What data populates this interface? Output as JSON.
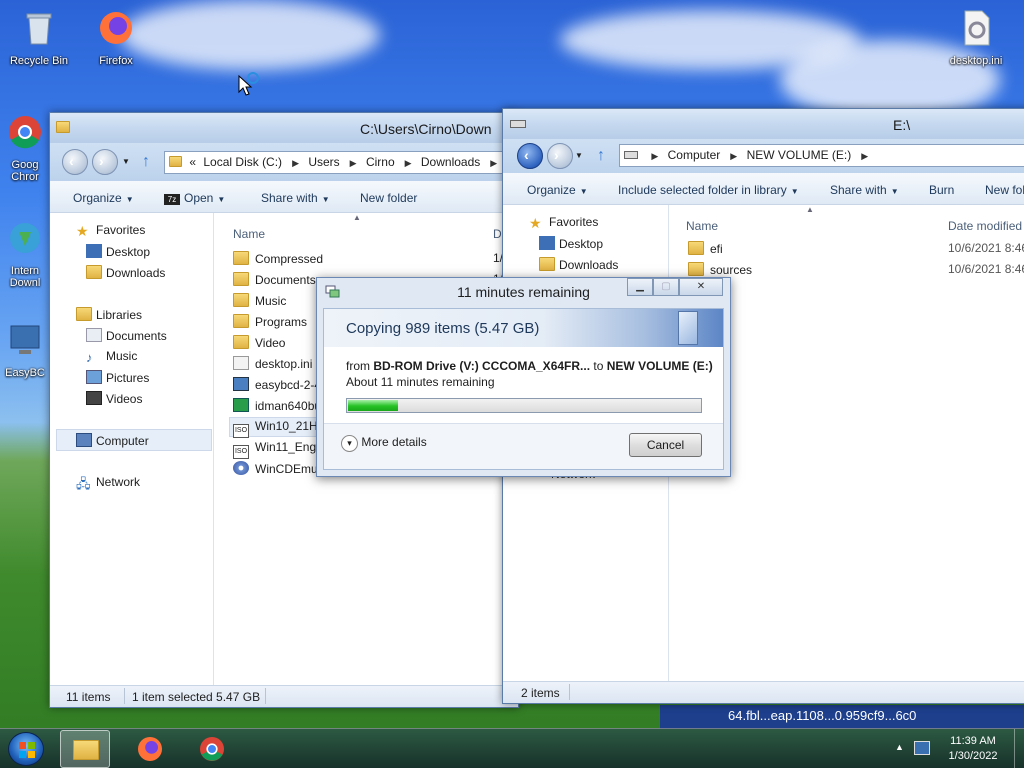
{
  "desktop": {
    "icons": [
      {
        "label": "Recycle Bin",
        "icon": "recycle-bin-icon"
      },
      {
        "label": "Firefox",
        "icon": "firefox-icon"
      },
      {
        "label": "desktop.ini",
        "icon": "settings-file-icon"
      },
      {
        "label": "Goog Chror",
        "icon": "chrome-icon"
      },
      {
        "label": "Intern Downl",
        "icon": "download-manager-icon"
      },
      {
        "label": "EasyBC",
        "icon": "easybcd-icon"
      }
    ],
    "wallpaper_text": "64.fbl...eap.1108...0.959cf9...6c0"
  },
  "left_window": {
    "title": "C:\\Users\\Cirno\\Down",
    "address": {
      "prefix": "«",
      "parts": [
        "Local Disk (C:)",
        "Users",
        "Cirno",
        "Downloads"
      ]
    },
    "toolbar": {
      "organize": "Organize",
      "open": "Open",
      "share": "Share with",
      "new_folder": "New folder"
    },
    "nav": {
      "favorites": "Favorites",
      "desktop": "Desktop",
      "downloads": "Downloads",
      "libraries": "Libraries",
      "documents": "Documents",
      "music": "Music",
      "pictures": "Pictures",
      "videos": "Videos",
      "computer": "Computer",
      "network": "Network"
    },
    "col_name": "Name",
    "col_date": "D",
    "files": [
      {
        "name": "Compressed",
        "type": "folder",
        "date": "1/"
      },
      {
        "name": "Documents",
        "type": "folder",
        "date": "1/"
      },
      {
        "name": "Music",
        "type": "folder",
        "date": ""
      },
      {
        "name": "Programs",
        "type": "folder",
        "date": ""
      },
      {
        "name": "Video",
        "type": "folder",
        "date": ""
      },
      {
        "name": "desktop.ini",
        "type": "ini",
        "date": ""
      },
      {
        "name": "easybcd-2-4",
        "type": "exe",
        "date": ""
      },
      {
        "name": "idman640bu",
        "type": "exe",
        "date": ""
      },
      {
        "name": "Win10_21H2",
        "type": "iso",
        "date": ""
      },
      {
        "name": "Win11_Engli",
        "type": "iso",
        "date": ""
      },
      {
        "name": "WinCDEmu-",
        "type": "exe",
        "date": ""
      }
    ],
    "status": {
      "count": "11 items",
      "selected": "1 item selected  5.47 GB"
    }
  },
  "right_window": {
    "title": "E:\\",
    "address": {
      "parts": [
        "Computer",
        "NEW VOLUME (E:)"
      ]
    },
    "toolbar": {
      "organize": "Organize",
      "include": "Include selected folder in library",
      "share": "Share with",
      "burn": "Burn",
      "new_folder": "New fol"
    },
    "nav": {
      "favorites": "Favorites",
      "desktop": "Desktop",
      "downloads": "Downloads",
      "network": "Network"
    },
    "col_name": "Name",
    "col_date": "Date modified",
    "files": [
      {
        "name": "efi",
        "date": "10/6/2021 8:46"
      },
      {
        "name": "sources",
        "date": "10/6/2021 8:46"
      }
    ],
    "status": {
      "count": "2 items"
    }
  },
  "copy_dialog": {
    "title": "11 minutes remaining",
    "heading": "Copying 989 items (5.47 GB)",
    "from_label": "from",
    "source": "BD-ROM Drive (V:) CCCOMA_X64FR...",
    "to_label": "to",
    "destination": "NEW VOLUME (E:)",
    "remaining": "About 11 minutes remaining",
    "progress": 0.14,
    "more_details": "More details",
    "cancel": "Cancel"
  },
  "taskbar": {
    "time": "11:39 AM",
    "date": "1/30/2022",
    "items": [
      "explorer-icon",
      "firefox-icon",
      "chrome-icon"
    ]
  },
  "colors": {
    "progress_fill": "#25c225",
    "title_bar": "#c5d8ef",
    "selection": "#e5eef9"
  }
}
